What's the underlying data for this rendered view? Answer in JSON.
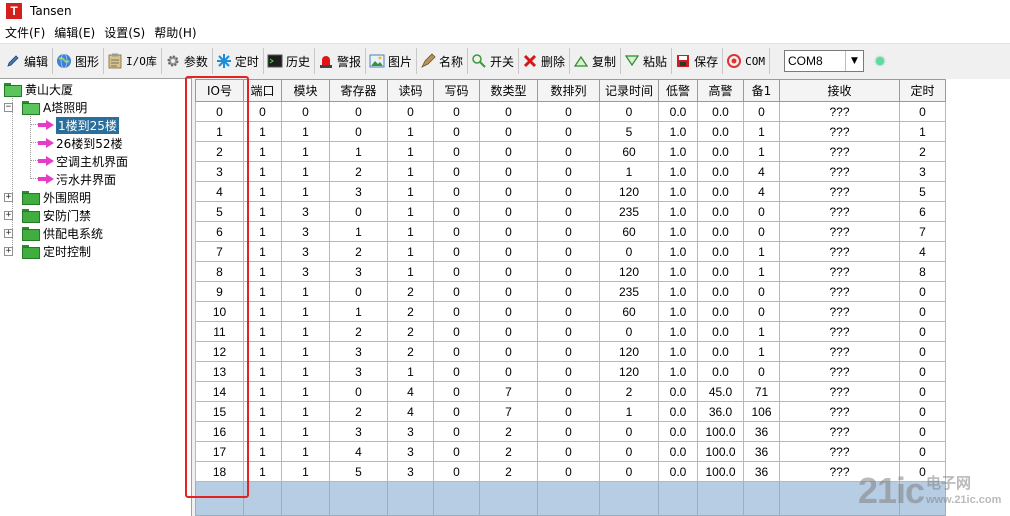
{
  "window": {
    "title": "Tansen",
    "logo_letter": "T"
  },
  "menu": [
    "文件(F)",
    "编辑(E)",
    "设置(S)",
    "帮助(H)"
  ],
  "toolbar": {
    "buttons": [
      {
        "label": "编辑",
        "icon": "pencil-icon"
      },
      {
        "label": "图形",
        "icon": "globe-icon"
      },
      {
        "label": "I/O库",
        "icon": "clipboard-icon"
      },
      {
        "label": "参数",
        "icon": "gear-icon"
      },
      {
        "label": "定时",
        "icon": "snowflake-icon"
      },
      {
        "label": "历史",
        "icon": "terminal-icon"
      },
      {
        "label": "警报",
        "icon": "alarm-light-icon"
      },
      {
        "label": "图片",
        "icon": "picture-icon"
      },
      {
        "label": "名称",
        "icon": "tag-icon"
      },
      {
        "label": "开关",
        "icon": "switch-icon"
      },
      {
        "label": "删除",
        "icon": "delete-x-icon"
      },
      {
        "label": "复制",
        "icon": "up-triangle-icon"
      },
      {
        "label": "粘贴",
        "icon": "down-triangle-icon"
      },
      {
        "label": "保存",
        "icon": "save-icon"
      },
      {
        "label": "COM",
        "icon": "com-port-icon"
      }
    ],
    "com_port": "COM8",
    "status_color": "#5fdc9e"
  },
  "tree": {
    "root": "黄山大厦",
    "groups": [
      {
        "label": "A塔照明",
        "expanded": true,
        "children": [
          "1楼到25楼",
          "26楼到52楼",
          "空调主机界面",
          "污水井界面"
        ],
        "selected_index": 0
      },
      {
        "label": "外围照明",
        "expanded": false
      },
      {
        "label": "安防门禁",
        "expanded": false
      },
      {
        "label": "供配电系统",
        "expanded": false
      },
      {
        "label": "定时控制",
        "expanded": false
      }
    ]
  },
  "table": {
    "columns": [
      "IO号",
      "端口",
      "模块",
      "寄存器",
      "读码",
      "写码",
      "数类型",
      "数排列",
      "记录时间",
      "低警",
      "高警",
      "备1",
      "接收",
      "定时"
    ],
    "rows": [
      [
        "0",
        "0",
        "0",
        "0",
        "0",
        "0",
        "0",
        "0",
        "0",
        "0.0",
        "0.0",
        "0",
        "???",
        "0"
      ],
      [
        "1",
        "1",
        "1",
        "0",
        "1",
        "0",
        "0",
        "0",
        "5",
        "1.0",
        "0.0",
        "1",
        "???",
        "1"
      ],
      [
        "2",
        "1",
        "1",
        "1",
        "1",
        "0",
        "0",
        "0",
        "60",
        "1.0",
        "0.0",
        "1",
        "???",
        "2"
      ],
      [
        "3",
        "1",
        "1",
        "2",
        "1",
        "0",
        "0",
        "0",
        "1",
        "1.0",
        "0.0",
        "4",
        "???",
        "3"
      ],
      [
        "4",
        "1",
        "1",
        "3",
        "1",
        "0",
        "0",
        "0",
        "120",
        "1.0",
        "0.0",
        "4",
        "???",
        "5"
      ],
      [
        "5",
        "1",
        "3",
        "0",
        "1",
        "0",
        "0",
        "0",
        "235",
        "1.0",
        "0.0",
        "0",
        "???",
        "6"
      ],
      [
        "6",
        "1",
        "3",
        "1",
        "1",
        "0",
        "0",
        "0",
        "60",
        "1.0",
        "0.0",
        "0",
        "???",
        "7"
      ],
      [
        "7",
        "1",
        "3",
        "2",
        "1",
        "0",
        "0",
        "0",
        "0",
        "1.0",
        "0.0",
        "1",
        "???",
        "4"
      ],
      [
        "8",
        "1",
        "3",
        "3",
        "1",
        "0",
        "0",
        "0",
        "120",
        "1.0",
        "0.0",
        "1",
        "???",
        "8"
      ],
      [
        "9",
        "1",
        "1",
        "0",
        "2",
        "0",
        "0",
        "0",
        "235",
        "1.0",
        "0.0",
        "0",
        "???",
        "0"
      ],
      [
        "10",
        "1",
        "1",
        "1",
        "2",
        "0",
        "0",
        "0",
        "60",
        "1.0",
        "0.0",
        "0",
        "???",
        "0"
      ],
      [
        "11",
        "1",
        "1",
        "2",
        "2",
        "0",
        "0",
        "0",
        "0",
        "1.0",
        "0.0",
        "1",
        "???",
        "0"
      ],
      [
        "12",
        "1",
        "1",
        "3",
        "2",
        "0",
        "0",
        "0",
        "120",
        "1.0",
        "0.0",
        "1",
        "???",
        "0"
      ],
      [
        "13",
        "1",
        "1",
        "3",
        "1",
        "0",
        "0",
        "0",
        "120",
        "1.0",
        "0.0",
        "0",
        "???",
        "0"
      ],
      [
        "14",
        "1",
        "1",
        "0",
        "4",
        "0",
        "7",
        "0",
        "2",
        "0.0",
        "45.0",
        "71",
        "???",
        "0"
      ],
      [
        "15",
        "1",
        "1",
        "2",
        "4",
        "0",
        "7",
        "0",
        "1",
        "0.0",
        "36.0",
        "106",
        "???",
        "0"
      ],
      [
        "16",
        "1",
        "1",
        "3",
        "3",
        "0",
        "2",
        "0",
        "0",
        "0.0",
        "100.0",
        "36",
        "???",
        "0"
      ],
      [
        "17",
        "1",
        "1",
        "4",
        "3",
        "0",
        "2",
        "0",
        "0",
        "0.0",
        "100.0",
        "36",
        "???",
        "0"
      ],
      [
        "18",
        "1",
        "1",
        "5",
        "3",
        "0",
        "2",
        "0",
        "0",
        "0.0",
        "100.0",
        "36",
        "???",
        "0"
      ]
    ]
  },
  "watermark": {
    "brand": "21ic",
    "cn": "电子网",
    "url": "www.21ic.com"
  }
}
